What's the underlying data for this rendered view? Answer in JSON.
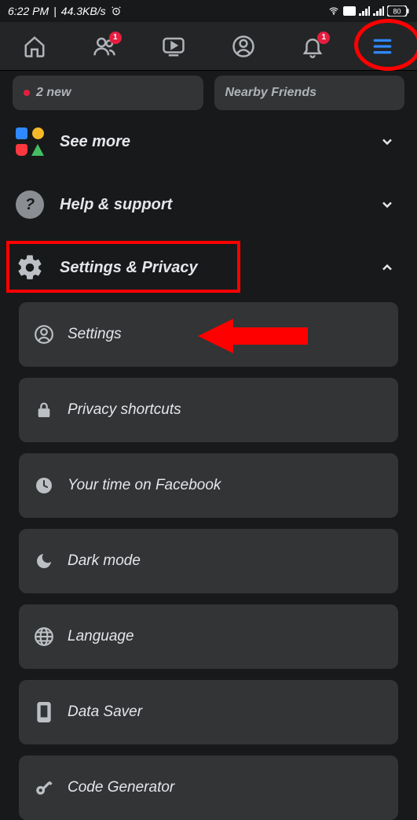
{
  "status": {
    "time": "6:22 PM",
    "net_speed": "44.3KB/s",
    "battery": "80"
  },
  "nav": {
    "friends_badge": "1",
    "notif_badge": "1"
  },
  "partial_cards": {
    "left": "2 new",
    "right": "Nearby Friends"
  },
  "menu": {
    "see_more": "See more",
    "help": "Help & support",
    "settings_privacy": "Settings & Privacy"
  },
  "subitems": [
    {
      "icon": "profile",
      "label": "Settings"
    },
    {
      "icon": "lock",
      "label": "Privacy shortcuts"
    },
    {
      "icon": "clock",
      "label": "Your time on Facebook"
    },
    {
      "icon": "moon",
      "label": "Dark mode"
    },
    {
      "icon": "globe",
      "label": "Language"
    },
    {
      "icon": "phone",
      "label": "Data Saver"
    },
    {
      "icon": "key",
      "label": "Code Generator"
    }
  ],
  "annotations": {
    "highlight_menu": true,
    "highlight_settings_row": true,
    "arrow_settings": true
  }
}
